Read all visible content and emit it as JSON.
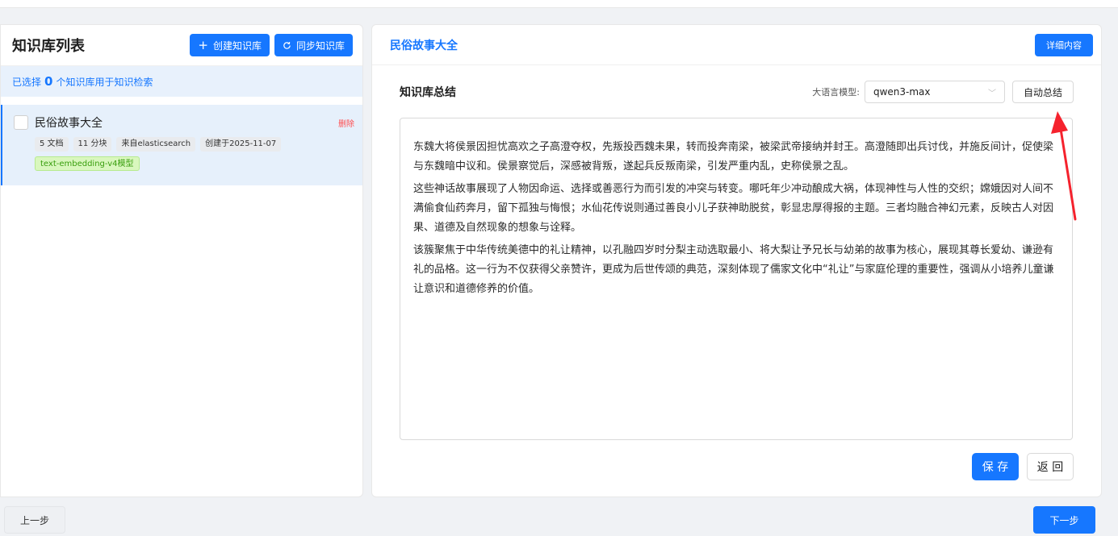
{
  "left_panel": {
    "title": "知识库列表",
    "create_label": "创建知识库",
    "sync_label": "同步知识库",
    "selection": {
      "prefix": "已选择",
      "count": "0",
      "suffix": "个知识库用于知识检索"
    },
    "items": [
      {
        "name": "民俗故事大全",
        "delete_label": "删除",
        "tags": [
          "5 文档",
          "11 分块",
          "来自elasticsearch",
          "创建于2025-11-07"
        ],
        "model_tag": "text-embedding-v4模型"
      }
    ]
  },
  "right_panel": {
    "title": "民俗故事大全",
    "detail_label": "详细内容",
    "summary_title": "知识库总结",
    "model_label": "大语言模型:",
    "model_value": "qwen3-max",
    "auto_summary_label": "自动总结",
    "paragraphs": [
      "东魏大将侯景因担忧高欢之子高澄夺权，先叛投西魏未果，转而投奔南梁，被梁武帝接纳并封王。高澄随即出兵讨伐，并施反间计，促使梁与东魏暗中议和。侯景察觉后，深感被背叛，遂起兵反叛南梁，引发严重内乱，史称侯景之乱。",
      "这些神话故事展现了人物因命运、选择或善恶行为而引发的冲突与转变。哪吒年少冲动酿成大祸，体现神性与人性的交织；嫦娥因对人间不满偷食仙药奔月，留下孤独与悔恨；水仙花传说则通过善良小儿子获神助脱贫，彰显忠厚得报的主题。三者均融合神幻元素，反映古人对因果、道德及自然现象的想象与诠释。",
      "该簇聚焦于中华传统美德中的礼让精神，以孔融四岁时分梨主动选取最小、将大梨让予兄长与幼弟的故事为核心，展现其尊长爱幼、谦逊有礼的品格。这一行为不仅获得父亲赞许，更成为后世传颂的典范，深刻体现了儒家文化中“礼让”与家庭伦理的重要性，强调从小培养儿童谦让意识和道德修养的价值。"
    ],
    "save_label": "保 存",
    "back_label": "返 回"
  },
  "footer": {
    "prev_label": "上一步",
    "next_label": "下一步"
  },
  "colors": {
    "primary": "#1677ff",
    "danger": "#ff4d4f",
    "annotation_arrow": "#f5222d"
  },
  "icons": {
    "create": "plus-icon",
    "sync": "refresh-icon",
    "select": "chevron-down-icon"
  }
}
